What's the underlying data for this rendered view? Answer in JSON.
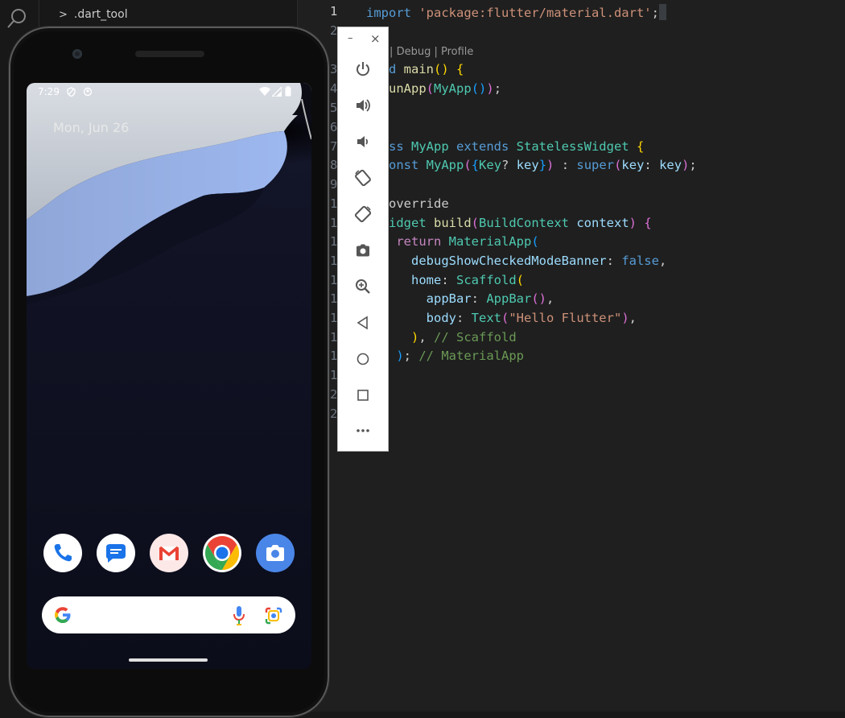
{
  "explorer": {
    "folder_label": ".dart_tool"
  },
  "editor": {
    "codelens": "Run | Debug | Profile",
    "lines": [
      {
        "n": "1",
        "tokens": [
          [
            "k1",
            "import "
          ],
          [
            "str",
            "'package:flutter/material.dart'"
          ],
          [
            "pl",
            ";"
          ]
        ]
      },
      {
        "n": "2",
        "tokens": []
      },
      {
        "n": "3",
        "tokens": [
          [
            "k1",
            "void "
          ],
          [
            "fn",
            "main"
          ],
          [
            "b1",
            "() {"
          ]
        ]
      },
      {
        "n": "4",
        "tokens": [
          [
            "pl",
            "  "
          ],
          [
            "fn",
            "runApp"
          ],
          [
            "b2",
            "("
          ],
          [
            "cls",
            "MyApp"
          ],
          [
            "b3",
            "()"
          ],
          [
            "b2",
            ")"
          ],
          [
            "pl",
            ";"
          ]
        ]
      },
      {
        "n": "5",
        "tokens": [
          [
            "b1",
            "}"
          ]
        ]
      },
      {
        "n": "6",
        "tokens": []
      },
      {
        "n": "7",
        "tokens": [
          [
            "k1",
            "class "
          ],
          [
            "cls",
            "MyApp "
          ],
          [
            "k1",
            "extends "
          ],
          [
            "cls",
            "StatelessWidget "
          ],
          [
            "b1",
            "{"
          ]
        ]
      },
      {
        "n": "8",
        "tokens": [
          [
            "pl",
            "  "
          ],
          [
            "k1",
            "const "
          ],
          [
            "cls",
            "MyApp"
          ],
          [
            "b2",
            "("
          ],
          [
            "b3",
            "{"
          ],
          [
            "cls",
            "Key"
          ],
          [
            "pl",
            "? "
          ],
          [
            "var",
            "key"
          ],
          [
            "b3",
            "}"
          ],
          [
            "b2",
            ")"
          ],
          [
            "pl",
            " : "
          ],
          [
            "k1",
            "super"
          ],
          [
            "b2",
            "("
          ],
          [
            "var",
            "key"
          ],
          [
            "pl",
            ": "
          ],
          [
            "var",
            "key"
          ],
          [
            "b2",
            ")"
          ],
          [
            "pl",
            ";"
          ]
        ]
      },
      {
        "n": "9",
        "tokens": []
      },
      {
        "n": "10",
        "tokens": [
          [
            "pl",
            "  "
          ],
          [
            "pl",
            "@override"
          ]
        ]
      },
      {
        "n": "11",
        "tokens": [
          [
            "pl",
            "  "
          ],
          [
            "cls",
            "Widget "
          ],
          [
            "fn",
            "build"
          ],
          [
            "b2",
            "("
          ],
          [
            "cls",
            "BuildContext "
          ],
          [
            "var",
            "context"
          ],
          [
            "b2",
            ") "
          ],
          [
            "b2",
            "{"
          ]
        ]
      },
      {
        "n": "12",
        "tokens": [
          [
            "pl",
            "    "
          ],
          [
            "k2",
            "return "
          ],
          [
            "cls",
            "MaterialApp"
          ],
          [
            "b3",
            "("
          ]
        ]
      },
      {
        "n": "13",
        "tokens": [
          [
            "pl",
            "      "
          ],
          [
            "var",
            "debugShowCheckedModeBanner"
          ],
          [
            "pl",
            ": "
          ],
          [
            "k1",
            "false"
          ],
          [
            "pl",
            ","
          ]
        ]
      },
      {
        "n": "14",
        "tokens": [
          [
            "pl",
            "      "
          ],
          [
            "var",
            "home"
          ],
          [
            "pl",
            ": "
          ],
          [
            "cls",
            "Scaffold"
          ],
          [
            "b1",
            "("
          ]
        ]
      },
      {
        "n": "15",
        "tokens": [
          [
            "pl",
            "        "
          ],
          [
            "var",
            "appBar"
          ],
          [
            "pl",
            ": "
          ],
          [
            "cls",
            "AppBar"
          ],
          [
            "b2",
            "()"
          ],
          [
            "pl",
            ","
          ]
        ]
      },
      {
        "n": "16",
        "tokens": [
          [
            "pl",
            "        "
          ],
          [
            "var",
            "body"
          ],
          [
            "pl",
            ": "
          ],
          [
            "cls",
            "Text"
          ],
          [
            "b2",
            "("
          ],
          [
            "str",
            "\"Hello Flutter\""
          ],
          [
            "b2",
            ")"
          ],
          [
            "pl",
            ","
          ]
        ]
      },
      {
        "n": "17",
        "tokens": [
          [
            "pl",
            "      "
          ],
          [
            "b1",
            ")"
          ],
          [
            "pl",
            ", "
          ],
          [
            "cmt",
            "// Scaffold"
          ]
        ]
      },
      {
        "n": "18",
        "tokens": [
          [
            "pl",
            "    "
          ],
          [
            "b3",
            ")"
          ],
          [
            "pl",
            "; "
          ],
          [
            "cmt",
            "// MaterialApp"
          ]
        ]
      },
      {
        "n": "19",
        "tokens": [
          [
            "pl",
            "  "
          ],
          [
            "b2",
            "}"
          ]
        ]
      },
      {
        "n": "20",
        "tokens": [
          [
            "b1",
            "}"
          ]
        ]
      },
      {
        "n": "21",
        "tokens": []
      }
    ]
  },
  "phone": {
    "time": "7:29",
    "date": "Mon, Jun 26",
    "dock_apps": [
      {
        "name": "phone-app-icon",
        "bg": "#ffffff"
      },
      {
        "name": "messages-app-icon",
        "bg": "#ffffff"
      },
      {
        "name": "gmail-app-icon",
        "bg": "#ffffff"
      },
      {
        "name": "chrome-app-icon",
        "bg": "#ffffff"
      },
      {
        "name": "camera-app-icon",
        "bg": "#4a86e8"
      }
    ]
  },
  "toolbar": {
    "minimize_glyph": "–",
    "close_glyph": "×",
    "buttons": [
      "power-icon",
      "volume-up-icon",
      "volume-down-icon",
      "rotate-left-icon",
      "rotate-right-icon",
      "screenshot-icon",
      "zoom-icon",
      "back-icon",
      "home-icon",
      "overview-icon",
      "more-icon"
    ]
  },
  "colors": {
    "accent_blue": "#4285f4",
    "editor_bg": "#1f1f1f",
    "toolbar_bg": "#ffffff"
  }
}
